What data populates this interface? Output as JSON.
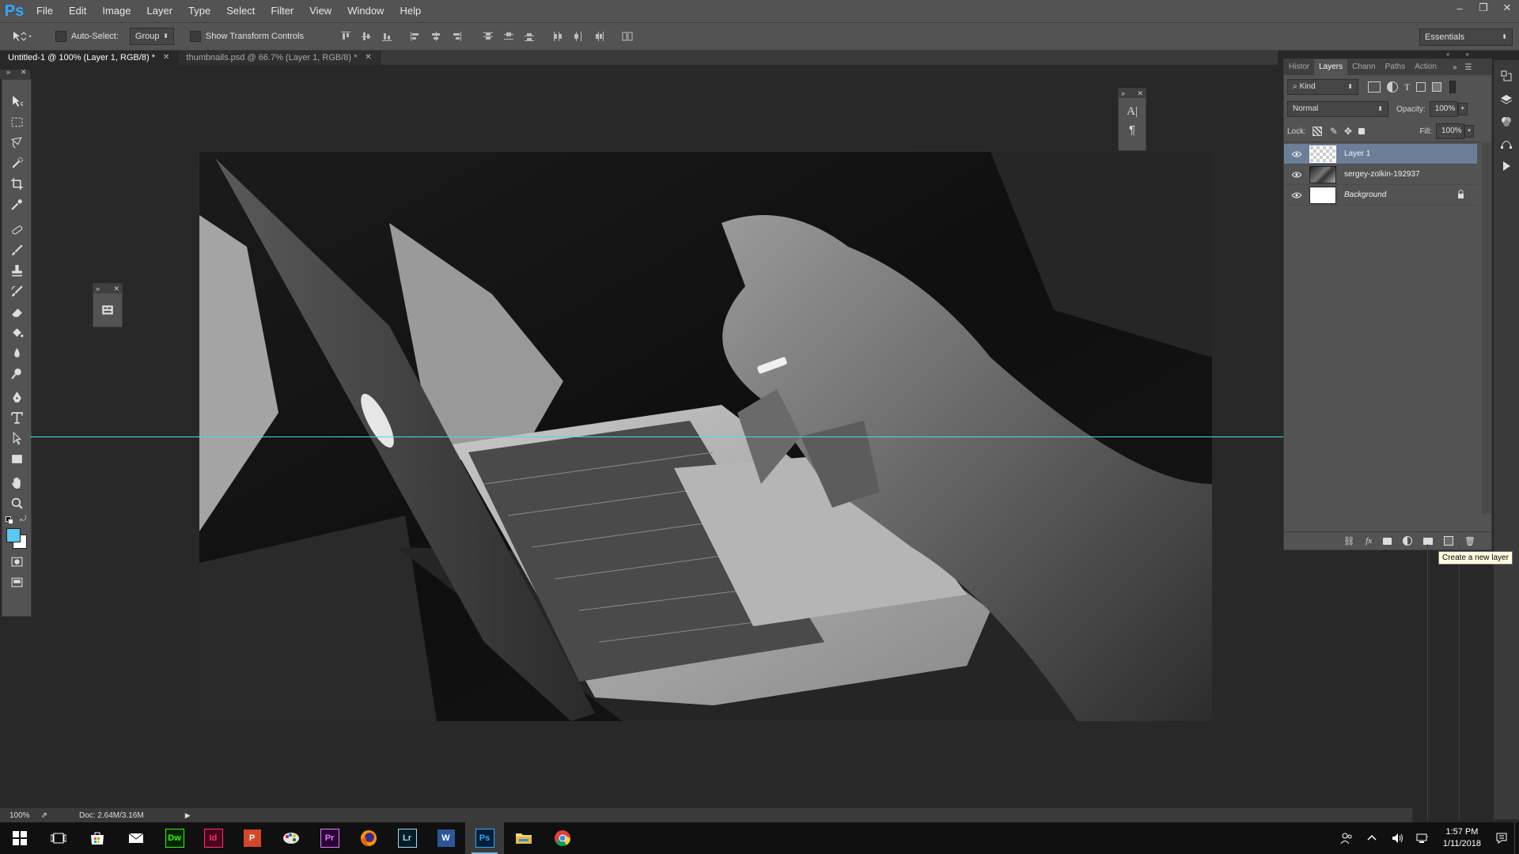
{
  "app": {
    "logo": "Ps"
  },
  "menu": [
    "File",
    "Edit",
    "Image",
    "Layer",
    "Type",
    "Select",
    "Filter",
    "View",
    "Window",
    "Help"
  ],
  "window_controls": {
    "minimize": "–",
    "restore": "❐",
    "close": "✕"
  },
  "options_bar": {
    "auto_select_label": "Auto-Select:",
    "auto_select_value": "Group",
    "show_transform_label": "Show Transform Controls",
    "workspace": "Essentials"
  },
  "tabs": [
    {
      "label": "Untitled-1 @ 100% (Layer 1, RGB/8) *",
      "active": true
    },
    {
      "label": "thumbnails.psd @ 66.7% (Layer 1, RGB/8) *",
      "active": false
    }
  ],
  "layers_panel": {
    "tabs": [
      "Histor",
      "Layers",
      "Chann",
      "Paths",
      "Action"
    ],
    "active_tab": "Layers",
    "filter_kind": "Kind",
    "blend_mode": "Normal",
    "opacity_label": "Opacity:",
    "opacity_value": "100%",
    "lock_label": "Lock:",
    "fill_label": "Fill:",
    "fill_value": "100%",
    "layers": [
      {
        "name": "Layer 1",
        "selected": true,
        "thumb": "transparent"
      },
      {
        "name": "sergey-zolkin-192937",
        "selected": false,
        "thumb": "photo"
      },
      {
        "name": "Background",
        "selected": false,
        "thumb": "white",
        "locked": true,
        "italic": true
      }
    ]
  },
  "tooltip": "Create a new layer",
  "status": {
    "zoom": "100%",
    "doc": "Doc: 2.64M/3.16M"
  },
  "char_panel": {
    "icon1": "A|",
    "icon2": "¶"
  },
  "taskbar": {
    "apps": [
      {
        "name": "task-view",
        "label": ""
      },
      {
        "name": "store",
        "label": ""
      },
      {
        "name": "mail",
        "label": ""
      },
      {
        "name": "dreamweaver",
        "label": "Dw",
        "color": "#35fa00",
        "bg": "#072401"
      },
      {
        "name": "indesign",
        "label": "Id",
        "color": "#ff3366",
        "bg": "#49021f"
      },
      {
        "name": "powerpoint",
        "label": "P",
        "color": "#ffffff",
        "bg": "#d24726"
      },
      {
        "name": "paint",
        "label": "",
        "color": "#ffffff",
        "bg": ""
      },
      {
        "name": "premiere",
        "label": "Pr",
        "color": "#e579ff",
        "bg": "#2a0634"
      },
      {
        "name": "firefox",
        "label": "",
        "color": "",
        "bg": ""
      },
      {
        "name": "lightroom",
        "label": "Lr",
        "color": "#add5ec",
        "bg": "#001d26"
      },
      {
        "name": "word",
        "label": "W",
        "color": "#ffffff",
        "bg": "#2b579a"
      },
      {
        "name": "photoshop",
        "label": "Ps",
        "color": "#31a8ff",
        "bg": "#001e36",
        "active": true
      },
      {
        "name": "explorer",
        "label": "",
        "color": "",
        "bg": ""
      },
      {
        "name": "chrome",
        "label": "",
        "color": "",
        "bg": ""
      }
    ],
    "time": "1:57 PM",
    "date": "1/11/2018"
  },
  "colors": {
    "foreground": "#5ac8f0",
    "background": "#ffffff",
    "guide": "#44e0e0"
  }
}
